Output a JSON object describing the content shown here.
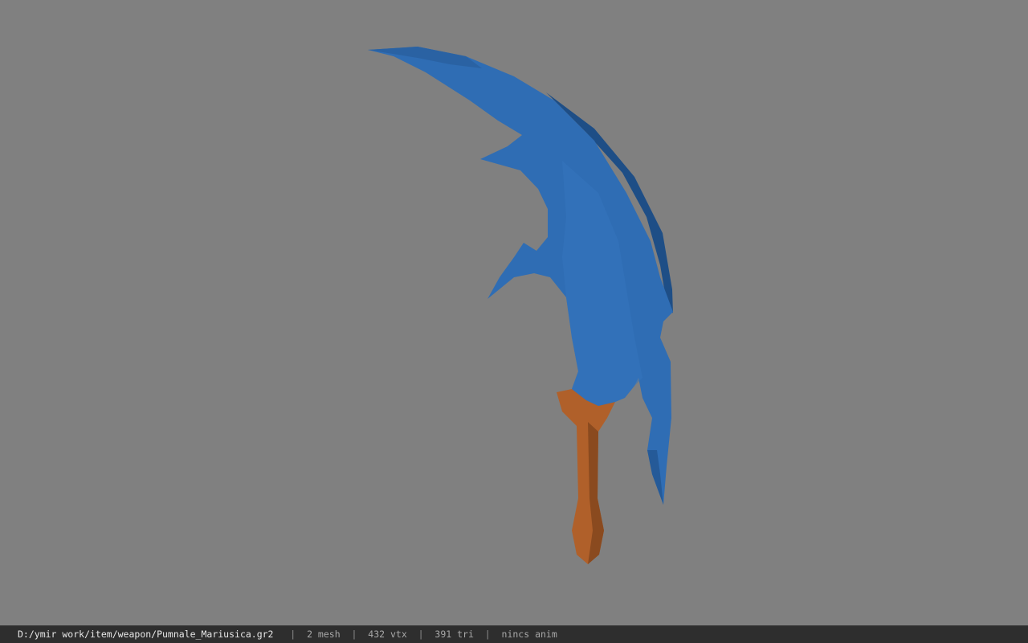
{
  "viewport": {
    "background_color": "#808080",
    "model": {
      "blade_color": "#2f6db4",
      "blade_shadow_color": "#1e4e86",
      "handle_color": "#b0602a",
      "handle_shadow_color": "#7a4119"
    }
  },
  "status_bar": {
    "file_path": "D:/ymir work/item/weapon/Pumnale_Mariusica.gr2",
    "separator": "|",
    "mesh_count": "2 mesh",
    "vertex_count": "432 vtx",
    "triangle_count": "391 tri",
    "animation_status": "nincs anim"
  }
}
